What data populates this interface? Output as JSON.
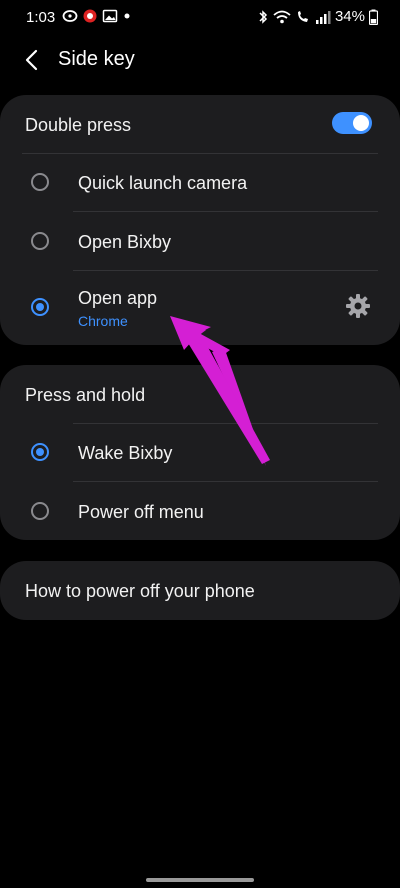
{
  "status_bar": {
    "time": "1:03",
    "battery": "34%",
    "icons_left": [
      "lastpass-icon",
      "record-icon",
      "gallery-icon",
      "dot-icon"
    ],
    "icons_right": [
      "bluetooth-icon",
      "wifi-icon",
      "wifi-call-icon",
      "signal-icon",
      "battery-icon"
    ]
  },
  "header": {
    "title": "Side key",
    "back_icon": "chevron-left-icon"
  },
  "double_press": {
    "label": "Double press",
    "toggle_on": true,
    "options": [
      {
        "label": "Quick launch camera",
        "selected": false
      },
      {
        "label": "Open Bixby",
        "selected": false
      },
      {
        "label": "Open app",
        "selected": true,
        "sublabel": "Chrome"
      }
    ],
    "settings_icon": "gear-icon"
  },
  "press_and_hold": {
    "label": "Press and hold",
    "options": [
      {
        "label": "Wake Bixby",
        "selected": true
      },
      {
        "label": "Power off menu",
        "selected": false
      }
    ]
  },
  "how_to": {
    "label": "How to power off your phone"
  },
  "colors": {
    "accent": "#3e91ff",
    "card_bg": "#1d1d1f",
    "arrow": "#d41fd4"
  }
}
